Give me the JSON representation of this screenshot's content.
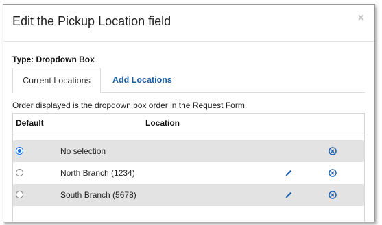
{
  "dialog": {
    "title": "Edit the Pickup Location field",
    "close_glyph": "×"
  },
  "type_label": "Type: Dropdown Box",
  "tabs": [
    {
      "label": "Current Locations",
      "active": true
    },
    {
      "label": "Add Locations",
      "active": false
    }
  ],
  "note": "Order displayed is the dropdown box order in the Request Form.",
  "table": {
    "headers": {
      "default": "Default",
      "location": "Location"
    },
    "rows": [
      {
        "name": "No selection",
        "default": true,
        "editable": false,
        "deletable": true
      },
      {
        "name": "North Branch (1234)",
        "default": false,
        "editable": true,
        "deletable": true
      },
      {
        "name": "South Branch (5678)",
        "default": false,
        "editable": true,
        "deletable": true
      }
    ]
  },
  "colors": {
    "accent": "#1d5fa3",
    "radio_checked": "#1a73e8",
    "row_shade": "#e3e3e3",
    "icon_blue": "#1f63b4"
  },
  "icons": {
    "edit": "pencil-icon",
    "delete": "circle-x-icon",
    "close": "close-icon"
  }
}
